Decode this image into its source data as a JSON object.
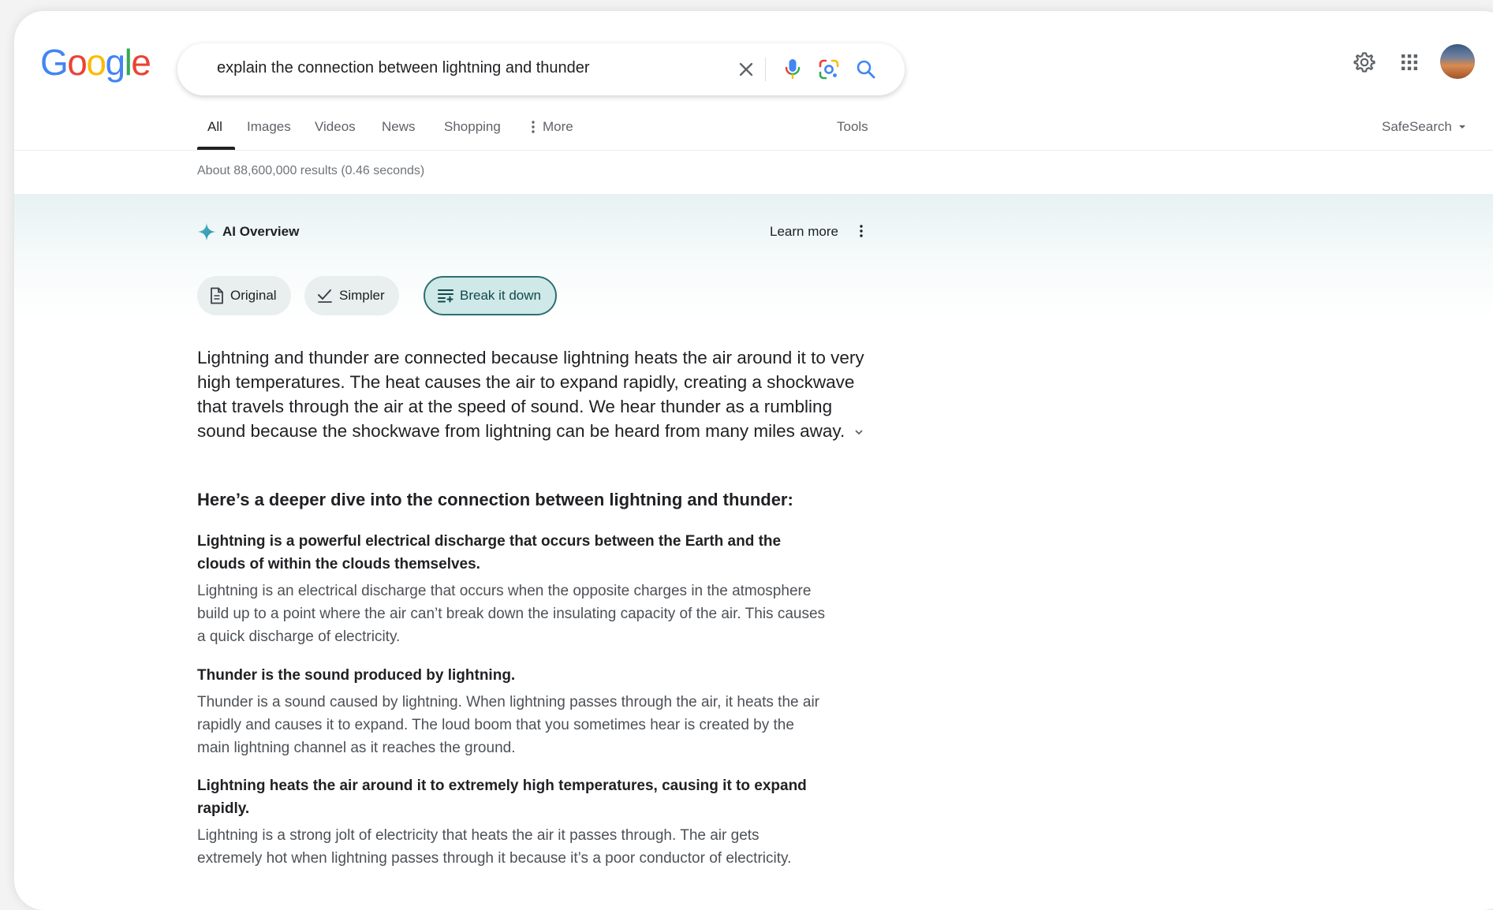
{
  "header": {
    "logo_letters": [
      {
        "ch": "G",
        "color": "#4285F4"
      },
      {
        "ch": "o",
        "color": "#EA4335"
      },
      {
        "ch": "o",
        "color": "#FBBC05"
      },
      {
        "ch": "g",
        "color": "#4285F4"
      },
      {
        "ch": "l",
        "color": "#34A853"
      },
      {
        "ch": "e",
        "color": "#EA4335"
      }
    ],
    "search": {
      "query": "explain the connection between lightning and thunder"
    }
  },
  "nav": {
    "tabs": [
      "All",
      "Images",
      "Videos",
      "News",
      "Shopping",
      "More"
    ],
    "active_tab": "All",
    "tools_label": "Tools",
    "safesearch_label": "SafeSearch"
  },
  "results_stats": "About 88,600,000 results (0.46 seconds)",
  "ai_overview": {
    "title": "AI Overview",
    "learn_more": "Learn more",
    "chips": [
      "Original",
      "Simpler",
      "Break it down"
    ],
    "selected_chip": "Break it down",
    "lead": "Lightning and thunder are connected because lightning heats the air around it to very high temperatures. The heat causes the air to expand rapidly, creating a shockwave that travels through the air at the speed of sound. We hear thunder as a rumbling sound because the shockwave from lightning can be heard from many miles away.",
    "deep_dive_heading": "Here’s a deeper dive into the connection between lightning and thunder:",
    "sections": [
      {
        "heading": "Lightning is a powerful electrical discharge that occurs between the Earth and the clouds of within the clouds themselves.",
        "body": "Lightning is an electrical discharge that occurs when the opposite charges in the atmosphere build up to a point where the air can’t break down the insulating capacity of the air. This causes a quick discharge of electricity."
      },
      {
        "heading": "Thunder is the sound produced by lightning.",
        "body": "Thunder is a sound caused by lightning. When lightning passes through the air, it heats the air rapidly and causes it to expand. The loud boom that you sometimes hear is created by the main lightning channel as it reaches the ground."
      },
      {
        "heading": "Lightning heats the air around it to extremely high temperatures, causing it to expand rapidly.",
        "body": "Lightning is a strong jolt of electricity that heats the air it passes through. The air gets extremely hot when lightning passes through it because it’s a poor conductor of electricity."
      }
    ]
  },
  "icons": {
    "clear": "close-icon",
    "voice": "microphone-icon",
    "lens": "google-lens-icon",
    "search": "search-icon",
    "settings": "gear-icon",
    "apps": "apps-grid-icon",
    "sparkle": "sparkle-icon"
  },
  "colors": {
    "accent_teal": "#2f6f70",
    "chip_bg": "#e8efee",
    "chip_selected_bg": "#cfe8e8",
    "search_blue": "#4285F4"
  }
}
